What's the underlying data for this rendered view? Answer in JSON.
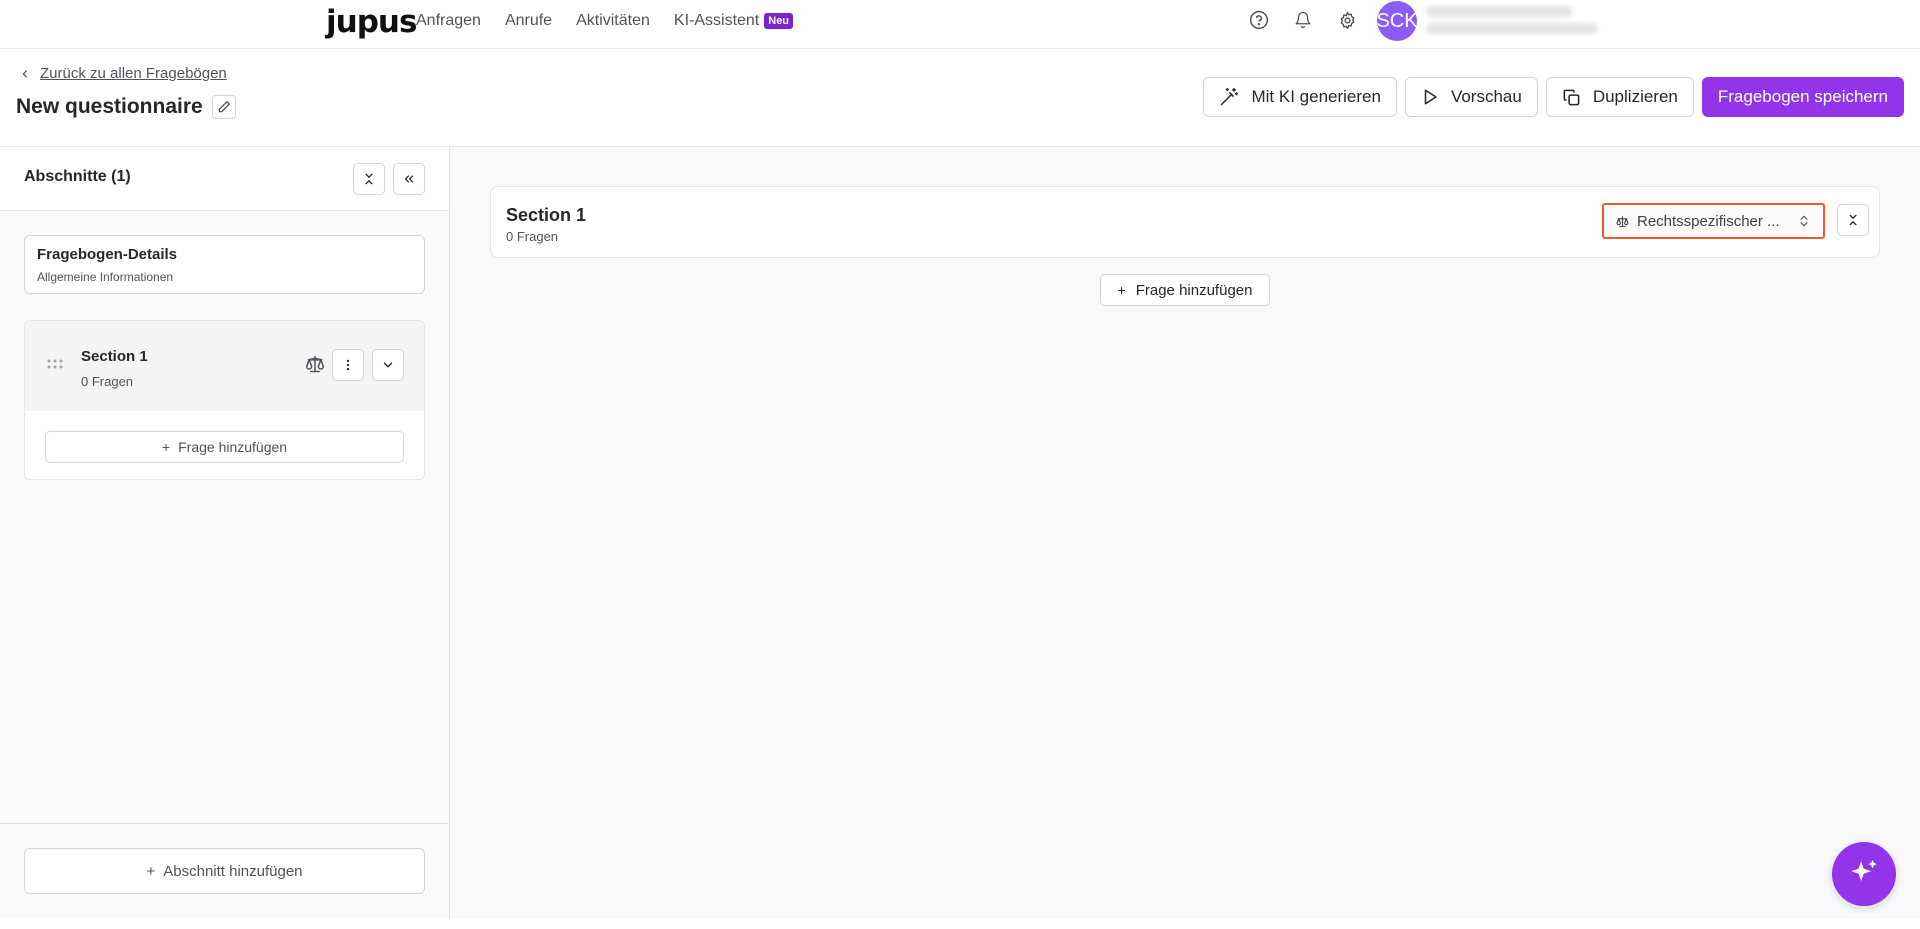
{
  "nav": {
    "logo": "jupus",
    "links": [
      "Anfragen",
      "Anrufe",
      "Aktivitäten"
    ],
    "ai_link": "KI-Assistent",
    "ai_badge": "Neu",
    "avatar_initials": "SCK",
    "icons": [
      "help-circle-icon",
      "bell-icon",
      "gear-icon"
    ]
  },
  "header": {
    "back_label": "Zurück zu allen Fragebögen",
    "title": "New questionnaire",
    "actions": {
      "generate": "Mit KI generieren",
      "preview": "Vorschau",
      "duplicate": "Duplizieren",
      "save": "Fragebogen speichern"
    }
  },
  "sidebar": {
    "title": "Abschnitte (1)",
    "details": {
      "title": "Fragebogen-Details",
      "subtitle": "Allgemeine Informationen"
    },
    "section": {
      "title": "Section 1",
      "subtitle": "0 Fragen",
      "add_question": "Frage hinzufügen"
    },
    "add_section": "Abschnitt hinzufügen"
  },
  "main": {
    "section": {
      "title": "Section 1",
      "subtitle": "0 Fragen",
      "select_value": "Rechtsspezifischer ..."
    },
    "add_question": "Frage hinzufügen"
  },
  "colors": {
    "primary": "#9333ea",
    "badge": "#7e22ce",
    "avatar": "#8b5cf6",
    "focus_border": "#f05a28"
  }
}
